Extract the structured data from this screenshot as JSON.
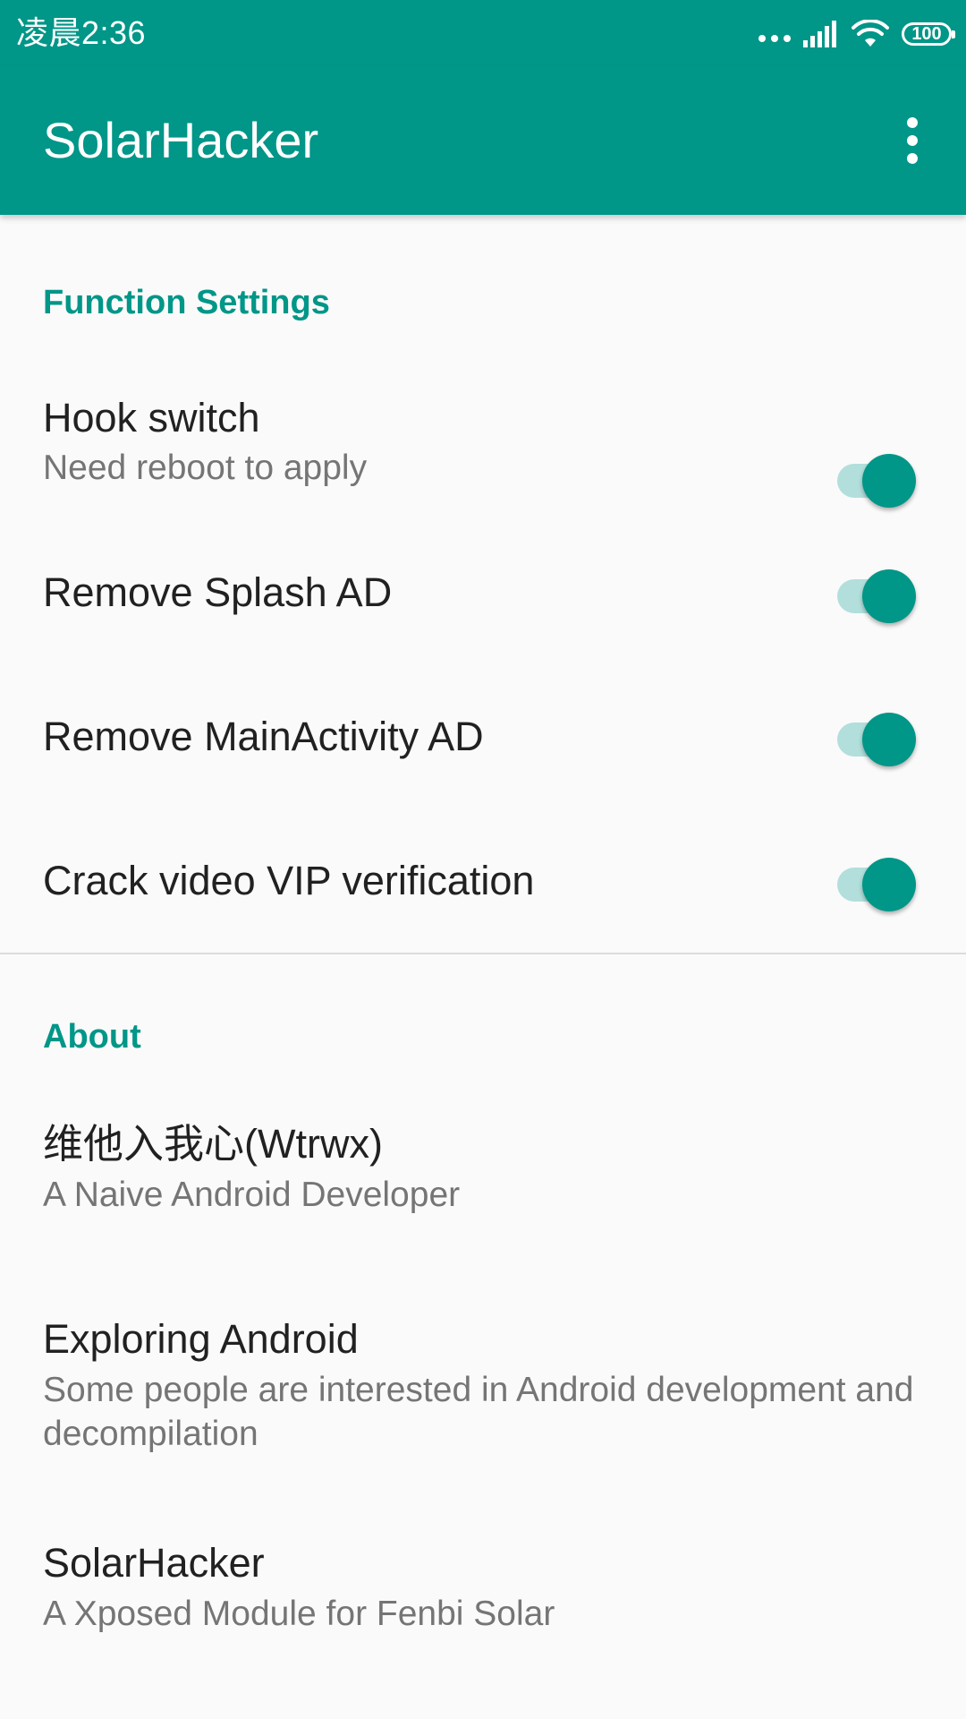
{
  "status_bar": {
    "time": "凌晨2:36",
    "battery_level": "100",
    "icons": [
      "more-dots-icon",
      "signal-icon",
      "wifi-icon",
      "battery-icon"
    ]
  },
  "app_bar": {
    "title": "SolarHacker",
    "overflow_icon": "more-vert-icon"
  },
  "colors": {
    "primary": "#009688",
    "track_on": "#b2dfdb",
    "title_text": "#212121",
    "summary_text": "#757575",
    "background": "#fafafa"
  },
  "function_settings": {
    "title": "Function Settings",
    "items": [
      {
        "title": "Hook switch",
        "summary": "Need reboot to apply",
        "checked": true
      },
      {
        "title": "Remove Splash AD",
        "checked": true
      },
      {
        "title": "Remove MainActivity AD",
        "checked": true
      },
      {
        "title": "Crack video VIP verification",
        "checked": true
      }
    ]
  },
  "about": {
    "title": "About",
    "items": [
      {
        "title": "维他入我心(Wtrwx)",
        "summary": "A Naive Android Developer"
      },
      {
        "title": "Exploring Android",
        "summary": "Some people are interested in Android development and decompilation"
      },
      {
        "title": "SolarHacker",
        "summary": "A Xposed Module for Fenbi Solar"
      }
    ]
  }
}
